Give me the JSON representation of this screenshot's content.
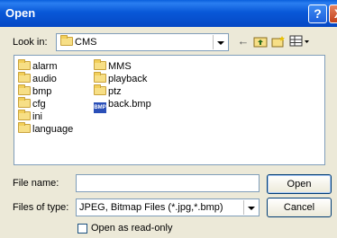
{
  "window": {
    "title": "Open",
    "help_label": "?",
    "close_label": "X"
  },
  "look_in": {
    "label": "Look in:",
    "value": "CMS"
  },
  "toolbar": {
    "back_icon": "back-arrow-icon",
    "up_icon": "up-folder-icon",
    "new_folder_icon": "new-folder-icon",
    "view_menu_icon": "view-menu-icon"
  },
  "files": {
    "column1": [
      {
        "name": "alarm",
        "type": "folder"
      },
      {
        "name": "audio",
        "type": "folder"
      },
      {
        "name": "bmp",
        "type": "folder"
      },
      {
        "name": "cfg",
        "type": "folder"
      },
      {
        "name": "ini",
        "type": "folder"
      },
      {
        "name": "language",
        "type": "folder"
      }
    ],
    "column2": [
      {
        "name": "MMS",
        "type": "folder"
      },
      {
        "name": "playback",
        "type": "folder"
      },
      {
        "name": "ptz",
        "type": "folder"
      },
      {
        "name": "back.bmp",
        "type": "bitmap"
      }
    ]
  },
  "file_name": {
    "label": "File name:",
    "value": ""
  },
  "file_type": {
    "label": "Files of type:",
    "value": "JPEG, Bitmap Files (*.jpg,*.bmp)"
  },
  "buttons": {
    "open": "Open",
    "cancel": "Cancel"
  },
  "read_only": {
    "label": "Open as read-only",
    "checked": false
  }
}
